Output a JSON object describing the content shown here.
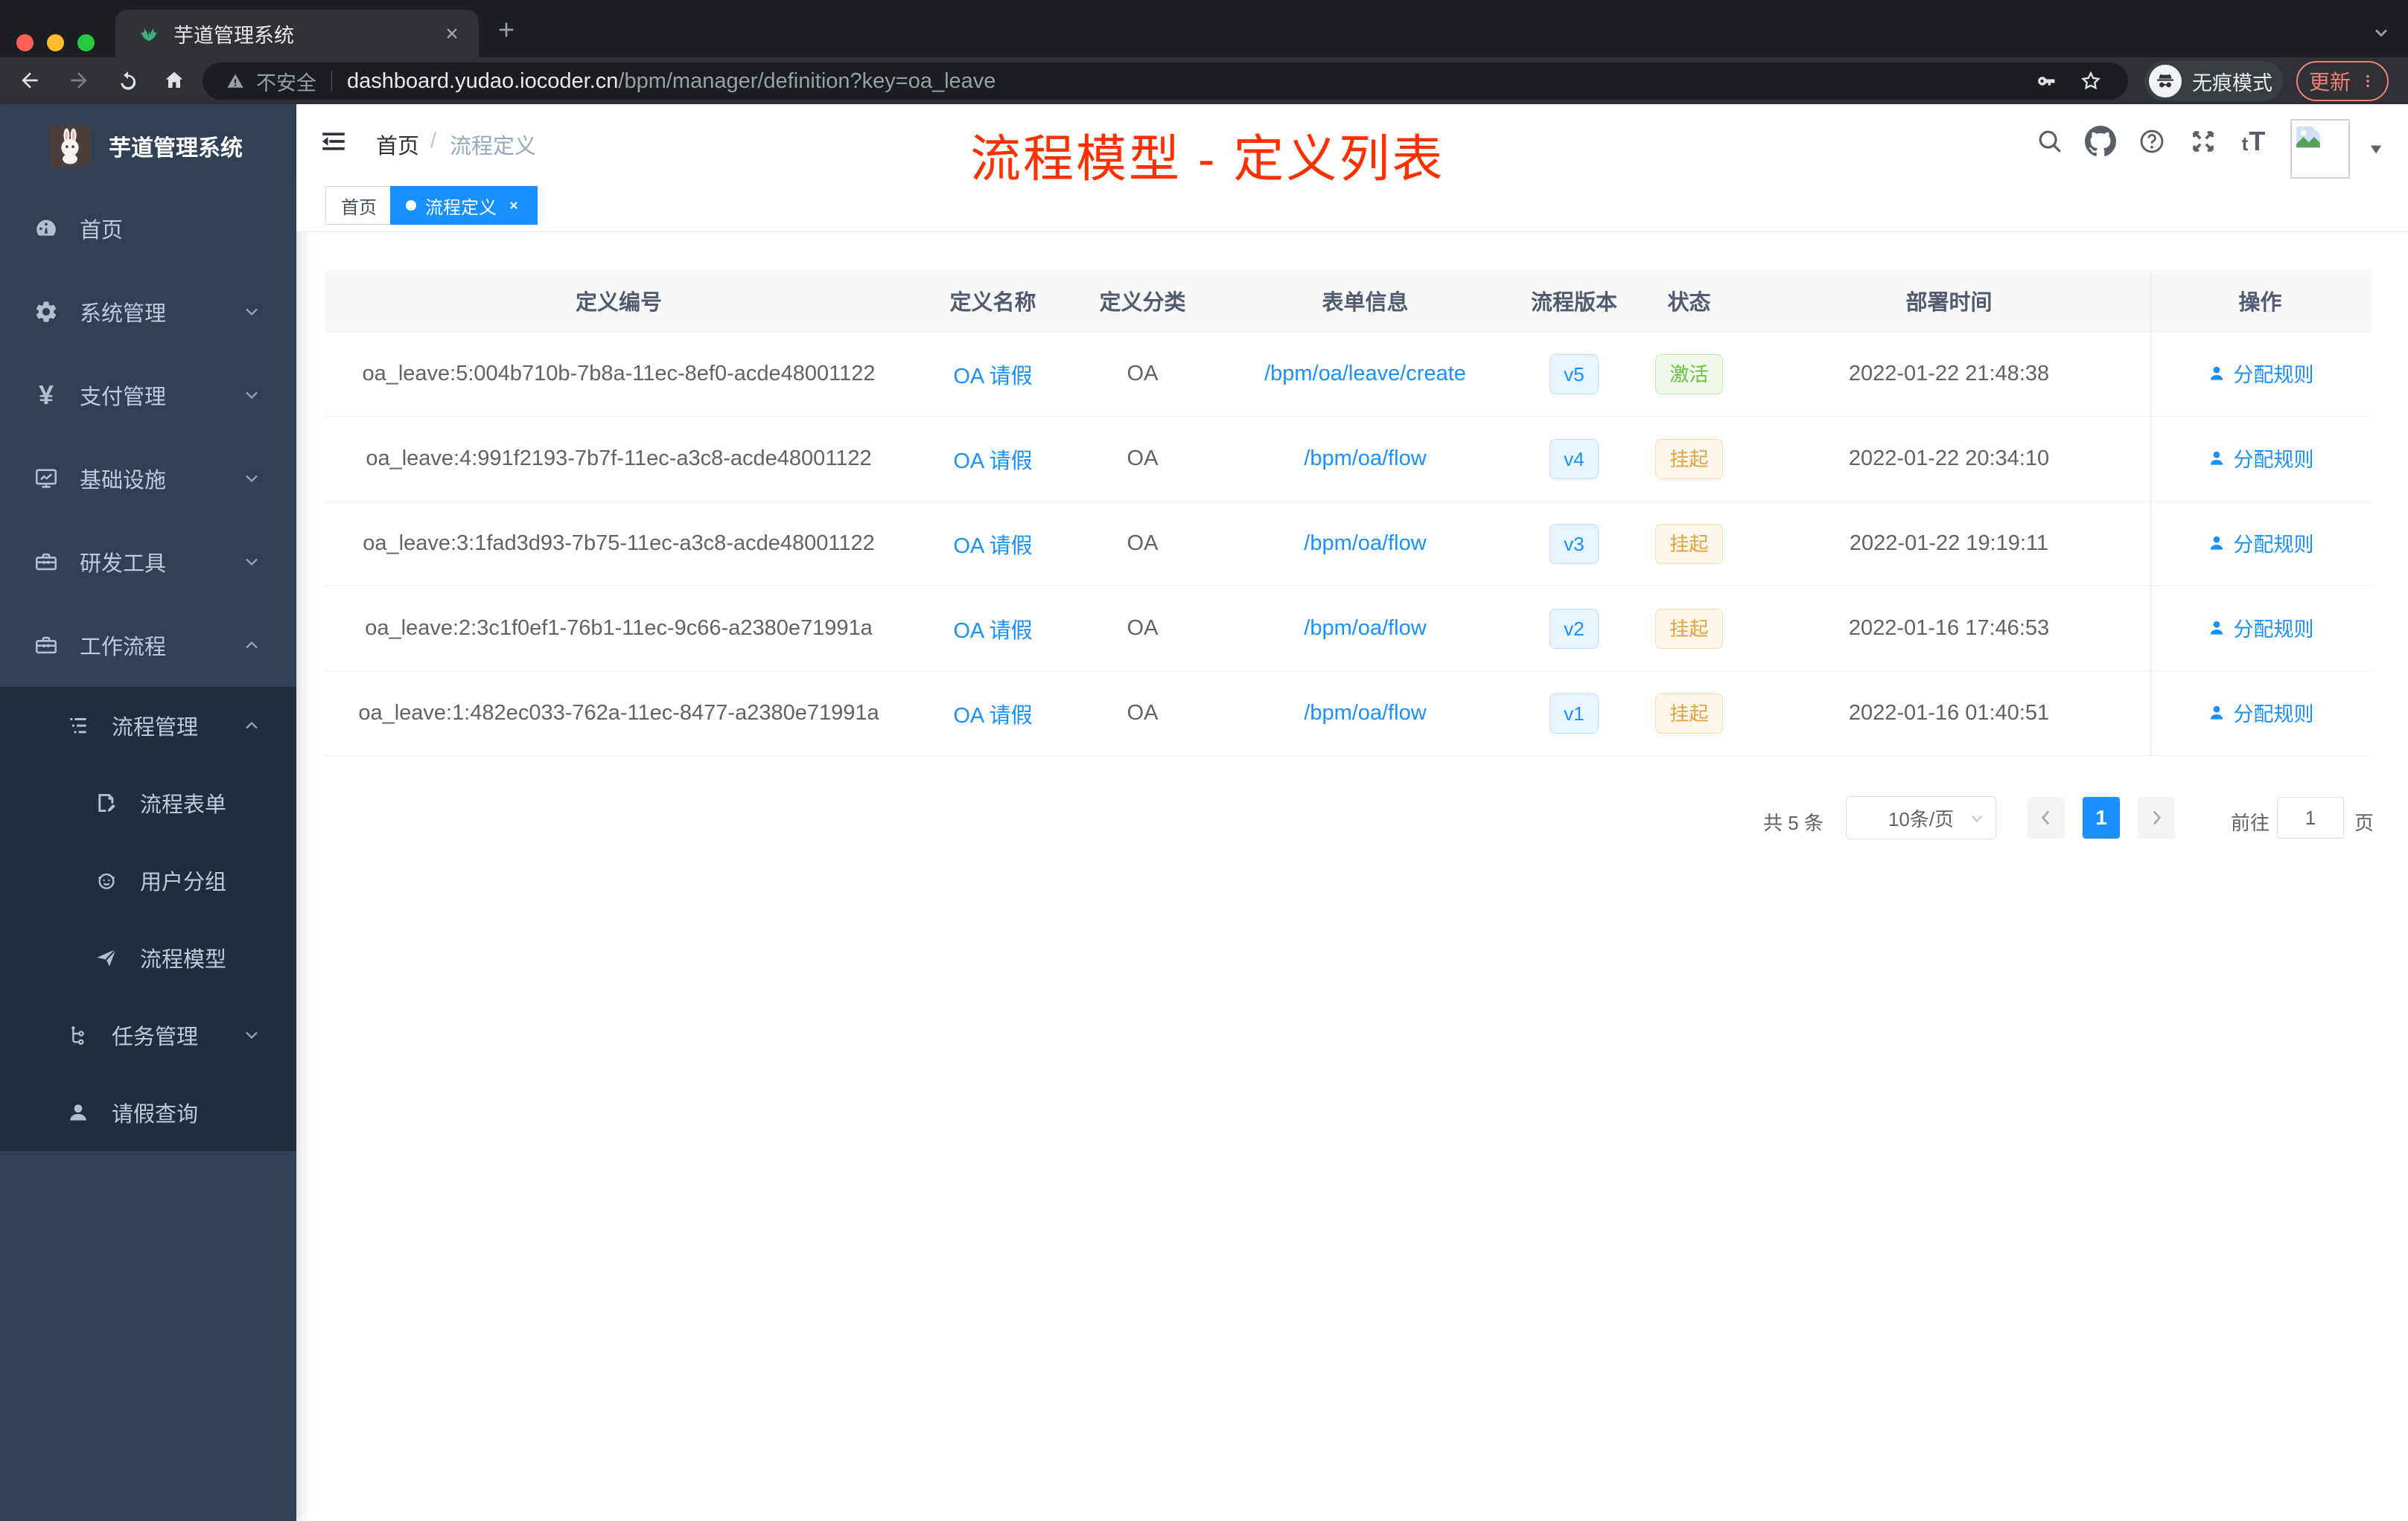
{
  "colors": {
    "accent": "#1890ff",
    "annotation_red": "#ff2f00",
    "sidebar_bg": "#304156",
    "submenu_bg": "#1f2d3d",
    "success_green": "#67c23a",
    "warning_orange": "#e6a23c"
  },
  "browser": {
    "tab_title": "芋道管理系统",
    "address": {
      "security": "不安全",
      "host": "dashboard.yudao.iocoder.cn",
      "path": "/bpm/manager/definition?key=oa_leave"
    },
    "incognito_label": "无痕模式",
    "update_label": "更新"
  },
  "sidebar": {
    "app_title": "芋道管理系统",
    "items": [
      {
        "label": "首页"
      },
      {
        "label": "系统管理"
      },
      {
        "label": "支付管理"
      },
      {
        "label": "基础设施"
      },
      {
        "label": "研发工具"
      },
      {
        "label": "工作流程"
      },
      {
        "label": "流程管理"
      },
      {
        "label": "流程表单"
      },
      {
        "label": "用户分组"
      },
      {
        "label": "流程模型"
      },
      {
        "label": "任务管理"
      },
      {
        "label": "请假查询"
      }
    ]
  },
  "navbar": {
    "breadcrumb": [
      "首页",
      "流程定义"
    ],
    "breadcrumb_sep": "/",
    "annotation": "流程模型 - 定义列表"
  },
  "tags": {
    "home": "首页",
    "active": "流程定义"
  },
  "table": {
    "columns": [
      "定义编号",
      "定义名称",
      "定义分类",
      "表单信息",
      "流程版本",
      "状态",
      "部署时间",
      "操作"
    ],
    "rows": [
      {
        "id": "oa_leave:5:004b710b-7b8a-11ec-8ef0-acde48001122",
        "name": "OA 请假",
        "category": "OA",
        "form": "/bpm/oa/leave/create",
        "version": "v5",
        "status": "激活",
        "status_type": "success",
        "time": "2022-01-22 21:48:38",
        "action": "分配规则"
      },
      {
        "id": "oa_leave:4:991f2193-7b7f-11ec-a3c8-acde48001122",
        "name": "OA 请假",
        "category": "OA",
        "form": "/bpm/oa/flow",
        "version": "v4",
        "status": "挂起",
        "status_type": "warning",
        "time": "2022-01-22 20:34:10",
        "action": "分配规则"
      },
      {
        "id": "oa_leave:3:1fad3d93-7b75-11ec-a3c8-acde48001122",
        "name": "OA 请假",
        "category": "OA",
        "form": "/bpm/oa/flow",
        "version": "v3",
        "status": "挂起",
        "status_type": "warning",
        "time": "2022-01-22 19:19:11",
        "action": "分配规则"
      },
      {
        "id": "oa_leave:2:3c1f0ef1-76b1-11ec-9c66-a2380e71991a",
        "name": "OA 请假",
        "category": "OA",
        "form": "/bpm/oa/flow",
        "version": "v2",
        "status": "挂起",
        "status_type": "warning",
        "time": "2022-01-16 17:46:53",
        "action": "分配规则"
      },
      {
        "id": "oa_leave:1:482ec033-762a-11ec-8477-a2380e71991a",
        "name": "OA 请假",
        "category": "OA",
        "form": "/bpm/oa/flow",
        "version": "v1",
        "status": "挂起",
        "status_type": "warning",
        "time": "2022-01-16 01:40:51",
        "action": "分配规则"
      }
    ]
  },
  "pagination": {
    "total": "共 5 条",
    "page_size": "10条/页",
    "current_page": "1",
    "goto": "前往",
    "goto_value": "1",
    "page_unit": "页"
  }
}
